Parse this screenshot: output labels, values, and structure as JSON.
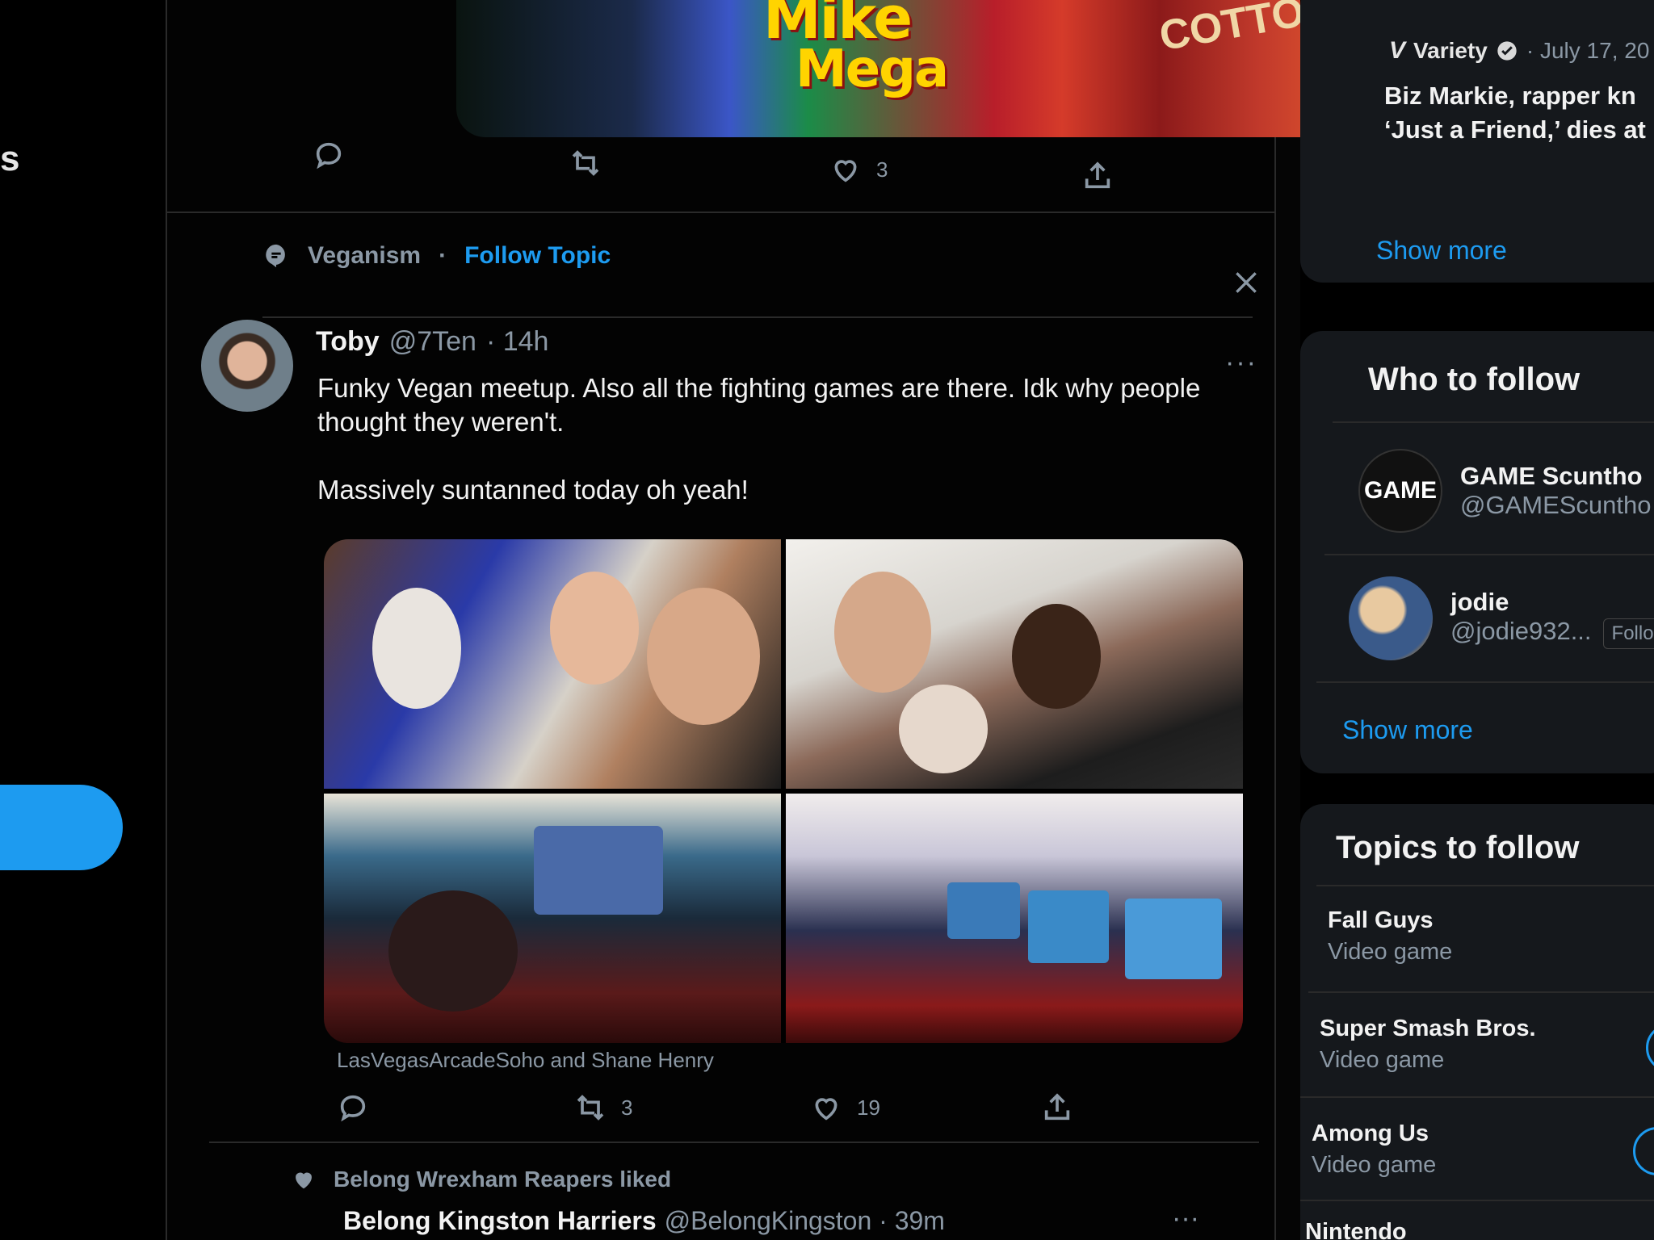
{
  "left_nav": {
    "fragment": "s"
  },
  "top_tweet": {
    "media_text_1": "Mike",
    "media_text_2": "Mega",
    "media_text_3": "COTTO",
    "like_count": "3"
  },
  "topic_bar": {
    "topic": "Veganism",
    "separator": "·",
    "follow_label": "Follow Topic"
  },
  "tweet": {
    "name": "Toby",
    "handle": "@7Ten",
    "time": "· 14h",
    "text": "Funky Vegan meetup. Also all the fighting games are there. Idk why people\nthought they weren't.\n\nMassively suntanned today oh yeah!",
    "caption": "LasVegasArcadeSoho and Shane Henry",
    "retweets": "3",
    "likes": "19",
    "more": "···"
  },
  "next_tweet": {
    "context": "Belong Wrexham Reapers liked",
    "name": "Belong Kingston Harriers",
    "handle": "@BelongKingston · 39m",
    "more": "···"
  },
  "sidebar": {
    "news": {
      "source": "Variety",
      "date": "· July 17, 20",
      "title_line1": "Biz Markie, rapper kn",
      "title_line2": "‘Just a Friend,’ dies at",
      "show_more": "Show more"
    },
    "who_to_follow": {
      "title": "Who to follow",
      "items": [
        {
          "avatar_text": "GAME",
          "name": "GAME Scuntho",
          "handle": "@GAMEScuntho"
        },
        {
          "avatar_text": "",
          "name": "jodie",
          "handle": "@jodie932...",
          "follow": "Follo"
        }
      ],
      "show_more": "Show more"
    },
    "topics": {
      "title": "Topics to follow",
      "items": [
        {
          "name": "Fall Guys",
          "category": "Video game"
        },
        {
          "name": "Super Smash Bros.",
          "category": "Video game"
        },
        {
          "name": "Among Us",
          "category": "Video game"
        },
        {
          "name": "Nintendo",
          "category": ""
        }
      ]
    }
  },
  "colors": {
    "accent": "#1d9bf0",
    "muted": "#8b98a5",
    "text": "#f2f2f2"
  }
}
